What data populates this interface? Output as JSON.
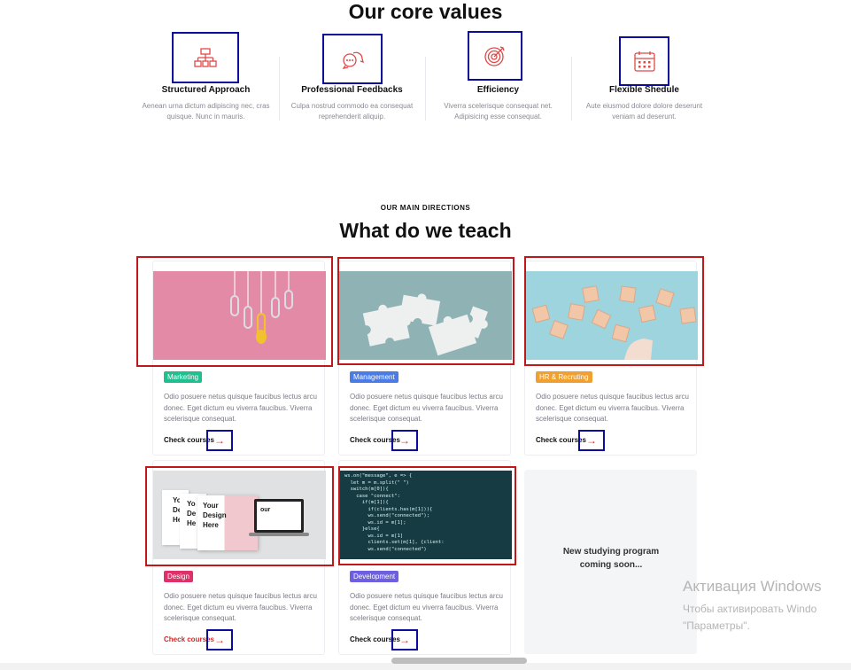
{
  "core_values": {
    "title": "Our core values",
    "items": [
      {
        "title": "Structured Approach",
        "desc": "Aenean urna dictum adipiscing nec, cras quisque. Nunc in mauris.",
        "icon": "hierarchy-icon"
      },
      {
        "title": "Professional Feedbacks",
        "desc": "Culpa nostrud commodo ea consequat reprehenderit aliquip.",
        "icon": "chat-bubbles-icon"
      },
      {
        "title": "Efficiency",
        "desc": "Viverra scelerisque consequat net. Adipisicing esse consequat.",
        "icon": "target-icon"
      },
      {
        "title": "Flexible Shedule",
        "desc": "Aute eiusmod dolore dolore deserunt veniam ad deserunt.",
        "icon": "calendar-icon"
      }
    ]
  },
  "directions": {
    "eyebrow": "OUR MAIN DIRECTIONS",
    "title": "What do we teach",
    "courses": [
      {
        "tag": "Marketing",
        "tag_color": "#1fbf8f",
        "desc": "Odio posuere netus quisque faucibus lectus arcu donec. Eget dictum eu viverra faucibus. Viverra scelerisque consequat.",
        "link": "Check courses",
        "arrow": "→",
        "image": "pink-paperclips-lightbulb"
      },
      {
        "tag": "Management",
        "tag_color": "#4b7be5",
        "desc": "Odio posuere netus quisque faucibus lectus arcu donec. Eget dictum eu viverra faucibus. Viverra scelerisque consequat.",
        "link": "Check courses",
        "arrow": "→",
        "image": "puzzle-pieces"
      },
      {
        "tag": "HR & Recruting",
        "tag_color": "#f0a030",
        "desc": "Odio posuere netus quisque faucibus lectus arcu donec. Eget dictum eu viverra faucibus. Viverra scelerisque consequat.",
        "link": "Check courses",
        "arrow": "→",
        "image": "people-blocks"
      },
      {
        "tag": "Design",
        "tag_color": "#e0306a",
        "desc": "Odio posuere netus quisque faucibus lectus arcu donec. Eget dictum eu viverra faucibus. Viverra scelerisque consequat.",
        "link": "Check courses",
        "arrow": "→",
        "image": "your-design-here-mockups",
        "link_color": "#d42a2a"
      },
      {
        "tag": "Development",
        "tag_color": "#6d5fe0",
        "desc": "Odio posuere netus quisque faucibus lectus arcu donec. Eget dictum eu viverra faucibus. Viverra scelerisque consequat.",
        "link": "Check courses",
        "arrow": "→",
        "image": "code-screen"
      }
    ],
    "coming_soon": "New studying program coming soon..."
  },
  "mockup_text": {
    "line1": "Your",
    "line2": "Design",
    "line3": "Here",
    "stub1": "Yo",
    "stub2": "De",
    "stub3": "He",
    "right": "our"
  },
  "code_lines": [
    "ws.on(\"message\", e => {",
    "  let m = m.split(\" \")",
    "  switch(m[0]){",
    "    case \"connect\":",
    "      if(m[1]){",
    "        if(clients.has(m[1])){",
    "        ws.send(\"connected\");",
    "        ws.id = m[1];",
    "      }else{",
    "        ws.id = m[1]",
    "        clients.set(m[1], {client:",
    "        ws.send(\"connected\")"
  ],
  "windows_activation": {
    "title": "Активация Windows",
    "line1": "Чтобы активировать Windo",
    "line2": "\"Параметры\"."
  }
}
